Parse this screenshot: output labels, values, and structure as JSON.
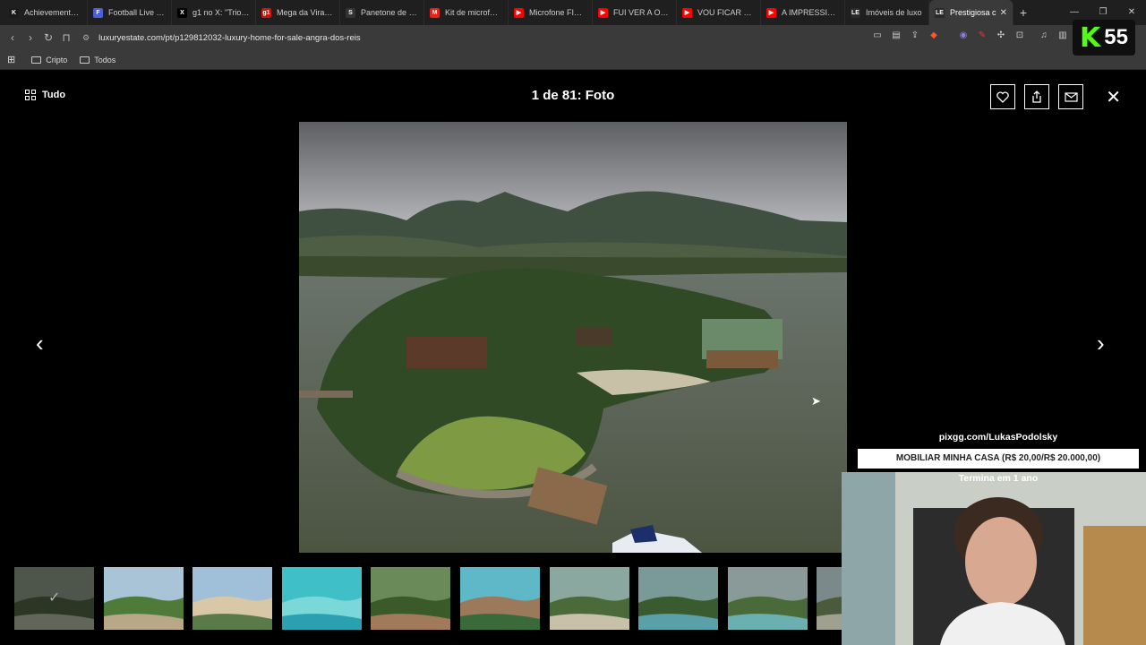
{
  "browser": {
    "tabs": [
      {
        "title": "Achievements - K",
        "color": "#1a1a1a",
        "glyph": "K"
      },
      {
        "title": "Football Live Scor",
        "color": "#4c5fd5",
        "glyph": "F"
      },
      {
        "title": "g1 no X: \"Trio de",
        "color": "#000000",
        "glyph": "X"
      },
      {
        "title": "Mega da Virada:",
        "color": "#c4170c",
        "glyph": "g1"
      },
      {
        "title": "Panetone de Got",
        "color": "#333333",
        "glyph": "S"
      },
      {
        "title": "Kit de microfone",
        "color": "#e2231a",
        "glyph": "M"
      },
      {
        "title": "Microfone FIFINE",
        "color": "#ff0000",
        "glyph": "▶"
      },
      {
        "title": "FUI VER A OBRA!",
        "color": "#ff0000",
        "glyph": "▶"
      },
      {
        "title": "VOU FICAR RICO",
        "color": "#ff0000",
        "glyph": "▶"
      },
      {
        "title": "A IMPRESSIONAN",
        "color": "#ff0000",
        "glyph": "▶"
      },
      {
        "title": "Imóveis de luxo",
        "color": "#2a2a2a",
        "glyph": "LE"
      },
      {
        "title": "Prestigiosa c",
        "color": "#2a2a2a",
        "glyph": "LE",
        "active": true
      }
    ],
    "url": "luxuryestate.com/pt/p129812032-luxury-home-for-sale-angra-dos-reis",
    "bookmarks": [
      "Cripto",
      "Todos"
    ]
  },
  "badge": {
    "letter": "K",
    "number": "55"
  },
  "gallery": {
    "all_label": "Tudo",
    "counter": "1 de 81: Foto",
    "thumb_count": 10
  },
  "overlay": {
    "link": "pixgg.com/LukasPodolsky",
    "goal": "MOBILIAR MINHA CASA (R$ 20,00/R$ 20.000,00)",
    "ends": "Termina em 1 ano"
  }
}
